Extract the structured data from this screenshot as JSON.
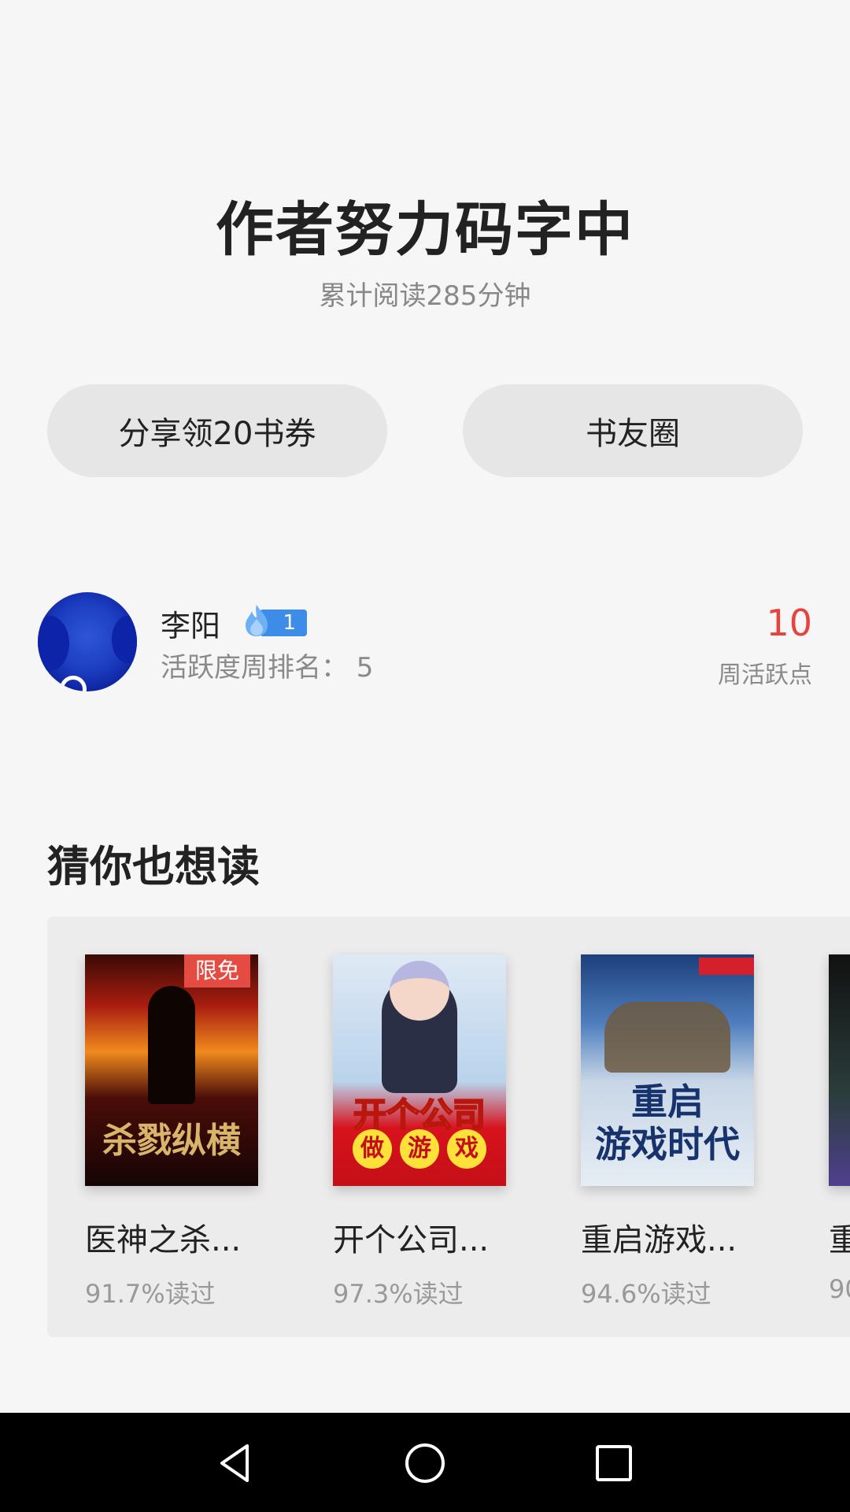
{
  "header": {
    "title": "作者努力码字中",
    "reading_stats": "累计阅读285分钟"
  },
  "actions": {
    "share_label": "分享领20书券",
    "circle_label": "书友圈"
  },
  "user": {
    "name": "李阳",
    "fire_level": "1",
    "weekly_rank": "活跃度周排名：  5",
    "points": "10",
    "points_label": "周活跃点"
  },
  "recommendations": {
    "title": "猜你也想读",
    "books": [
      {
        "title": "医神之杀...",
        "read_rate": "91.7%读过",
        "tag": "限免",
        "cover_text": "杀戮纵横"
      },
      {
        "title": "开个公司...",
        "read_rate": "97.3%读过",
        "cover_text": "开个公司",
        "cover_sub": [
          "做",
          "游",
          "戏"
        ]
      },
      {
        "title": "重启游戏...",
        "read_rate": "94.6%读过",
        "cover_text_1": "重启",
        "cover_text_2": "游戏时代"
      },
      {
        "title": "重",
        "read_rate": "90"
      }
    ]
  },
  "colors": {
    "accent_red": "#e8423f",
    "badge_blue": "#3d8de8",
    "free_tag": "#e34b43"
  },
  "navbar": {
    "icons": [
      "back-icon",
      "home-icon",
      "recent-apps-icon"
    ]
  }
}
